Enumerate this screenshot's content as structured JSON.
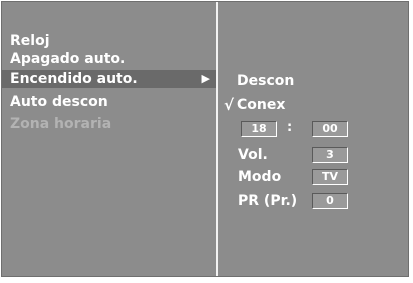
{
  "menu": {
    "items": [
      {
        "label": "Reloj"
      },
      {
        "label": "Apagado auto."
      },
      {
        "label": "Encendido auto."
      },
      {
        "label": "Auto descon"
      },
      {
        "label": "Zona horaria"
      }
    ],
    "selected_index": 2,
    "arrow_icon": "▶"
  },
  "submenu": {
    "off_label": "Descon",
    "on_label": "Conex",
    "check_icon": "√",
    "hour": "18",
    "separator": ":",
    "minute": "00",
    "volume_label": "Vol.",
    "volume_value": "3",
    "mode_label": "Modo",
    "mode_value": "TV",
    "program_label": "PR (Pr.)",
    "program_value": "0"
  }
}
